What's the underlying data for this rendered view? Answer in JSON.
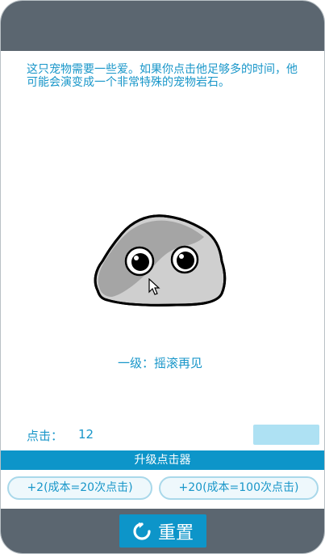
{
  "description": "这只宠物需要一些爱。如果你点击他足够多的时间，他可能会演变成一个非常特殊的宠物岩石。",
  "pet": {
    "icon": "pet-rock-icon"
  },
  "level": {
    "text": "一级：摇滚再见"
  },
  "stats": {
    "clicks_label": "点击：",
    "clicks_value": "12",
    "progress_fraction": 0
  },
  "upgrade": {
    "label": "升级点击器"
  },
  "buy_options": [
    {
      "label": "+2(成本=20次点击)"
    },
    {
      "label": "+20(成本=100次点击)"
    }
  ],
  "reset": {
    "label": "重置",
    "icon": "refresh-icon"
  },
  "colors": {
    "accent": "#0d95c9",
    "text": "#1896c9",
    "bar": "#5b6670",
    "progress_track": "#aee1f3"
  }
}
